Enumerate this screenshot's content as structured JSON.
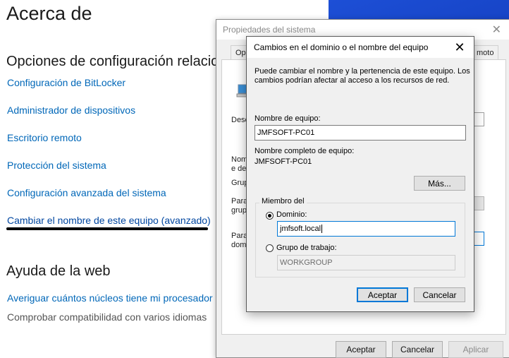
{
  "settings": {
    "title": "Acerca de",
    "related_title": "Opciones de configuración relacio",
    "links": [
      "Configuración de BitLocker",
      "Administrador de dispositivos",
      "Escritorio remoto",
      "Protección del sistema",
      "Configuración avanzada del sistema",
      "Cambiar el nombre de este equipo (avanzado)"
    ],
    "web_help_title": "Ayuda de la web",
    "web_link": "Averiguar cuántos núcleos tiene mi procesador",
    "web_plain": "Comprobar compatibilidad con varios idiomas"
  },
  "sysprops": {
    "title": "Propiedades del sistema",
    "tab_left": "Opc",
    "tab_right": "moto",
    "body_frag": [
      "Desc",
      "Nom",
      "e de",
      "Grup",
      "Para",
      "grup",
      "Para",
      "domi"
    ],
    "buttons": {
      "ok": "Aceptar",
      "cancel": "Cancelar",
      "apply": "Aplicar"
    }
  },
  "dialog": {
    "title": "Cambios en el dominio o el nombre del equipo",
    "close_glyph": "✕",
    "intro": [
      "Puede cambiar el nombre y la pertenencia de este equipo. Los",
      "cambios podrían afectar al acceso a los recursos de red."
    ],
    "computer_name_label": "Nombre de equipo:",
    "computer_name_value": "JMFSOFT-PC01",
    "full_name_label": "Nombre completo de equipo:",
    "full_name_value": "JMFSOFT-PC01",
    "more_button": "Más...",
    "member_of_label": "Miembro del",
    "domain_label": "Dominio:",
    "domain_value": "jmfsoft.local",
    "workgroup_label": "Grupo de trabajo:",
    "workgroup_value": "WORKGROUP",
    "ok_button": "Aceptar",
    "cancel_button": "Cancelar",
    "domain_selected": true
  }
}
